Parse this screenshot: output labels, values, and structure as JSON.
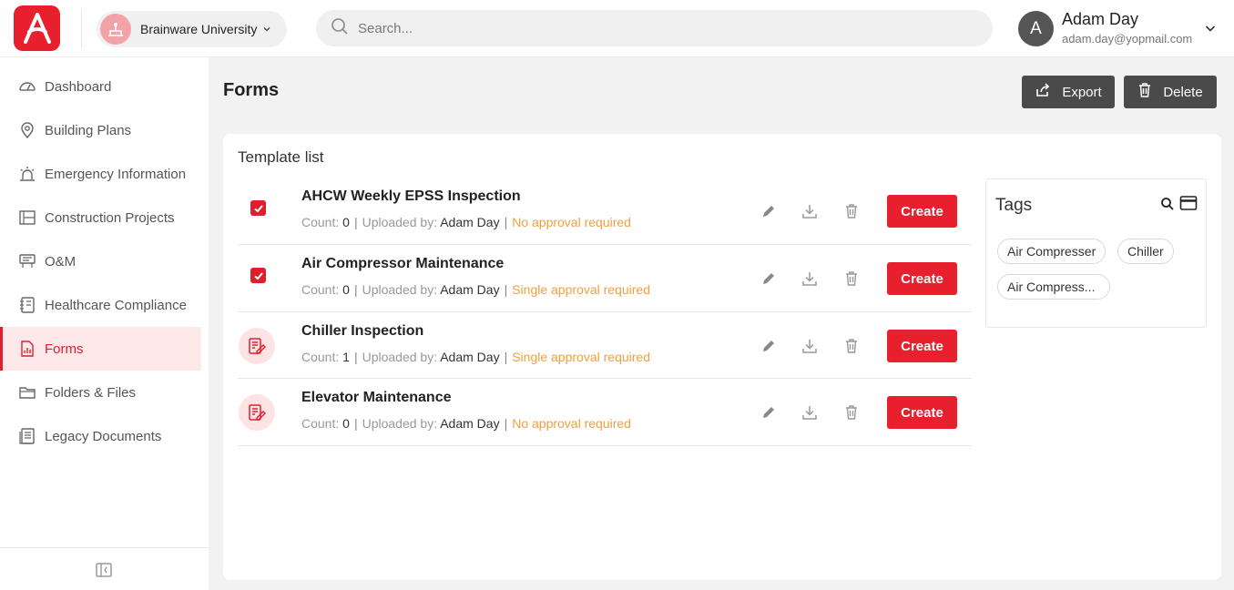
{
  "header": {
    "org_name": "Brainware University",
    "search_placeholder": "Search...",
    "user": {
      "initial": "A",
      "name": "Adam Day",
      "email": "adam.day@yopmail.com"
    }
  },
  "sidebar": {
    "items": [
      {
        "label": "Dashboard",
        "icon": "dashboard-icon",
        "active": false
      },
      {
        "label": "Building Plans",
        "icon": "map-pin-icon",
        "active": false
      },
      {
        "label": "Emergency Information",
        "icon": "alarm-icon",
        "active": false
      },
      {
        "label": "Construction Projects",
        "icon": "blueprint-icon",
        "active": false
      },
      {
        "label": "O&M",
        "icon": "presentation-icon",
        "active": false
      },
      {
        "label": "Healthcare Compliance",
        "icon": "notebook-icon",
        "active": false
      },
      {
        "label": "Forms",
        "icon": "form-chart-icon",
        "active": true
      },
      {
        "label": "Folders & Files",
        "icon": "folder-icon",
        "active": false
      },
      {
        "label": "Legacy Documents",
        "icon": "document-icon",
        "active": false
      }
    ]
  },
  "main": {
    "title": "Forms",
    "export_label": "Export",
    "delete_label": "Delete",
    "template_list_title": "Template list",
    "count_label": "Count:",
    "uploaded_label": "Uploaded by:",
    "create_label": "Create",
    "templates": [
      {
        "name": "AHCW Weekly EPSS Inspection",
        "count": "0",
        "uploaded_by": "Adam Day",
        "approval": "No approval required",
        "checked": true
      },
      {
        "name": "Air Compressor Maintenance",
        "count": "0",
        "uploaded_by": "Adam Day",
        "approval": "Single approval required",
        "checked": true
      },
      {
        "name": "Chiller Inspection",
        "count": "1",
        "uploaded_by": "Adam Day",
        "approval": "Single approval required",
        "checked": false
      },
      {
        "name": "Elevator Maintenance",
        "count": "0",
        "uploaded_by": "Adam Day",
        "approval": "No approval required",
        "checked": false
      }
    ]
  },
  "tags": {
    "title": "Tags",
    "items": [
      "Air Compresser",
      "Chiller",
      "Air Compress..."
    ]
  },
  "colors": {
    "brand_red": "#e81f2d",
    "approval_orange": "#f0a040",
    "dark_button": "#4a4a4a"
  }
}
